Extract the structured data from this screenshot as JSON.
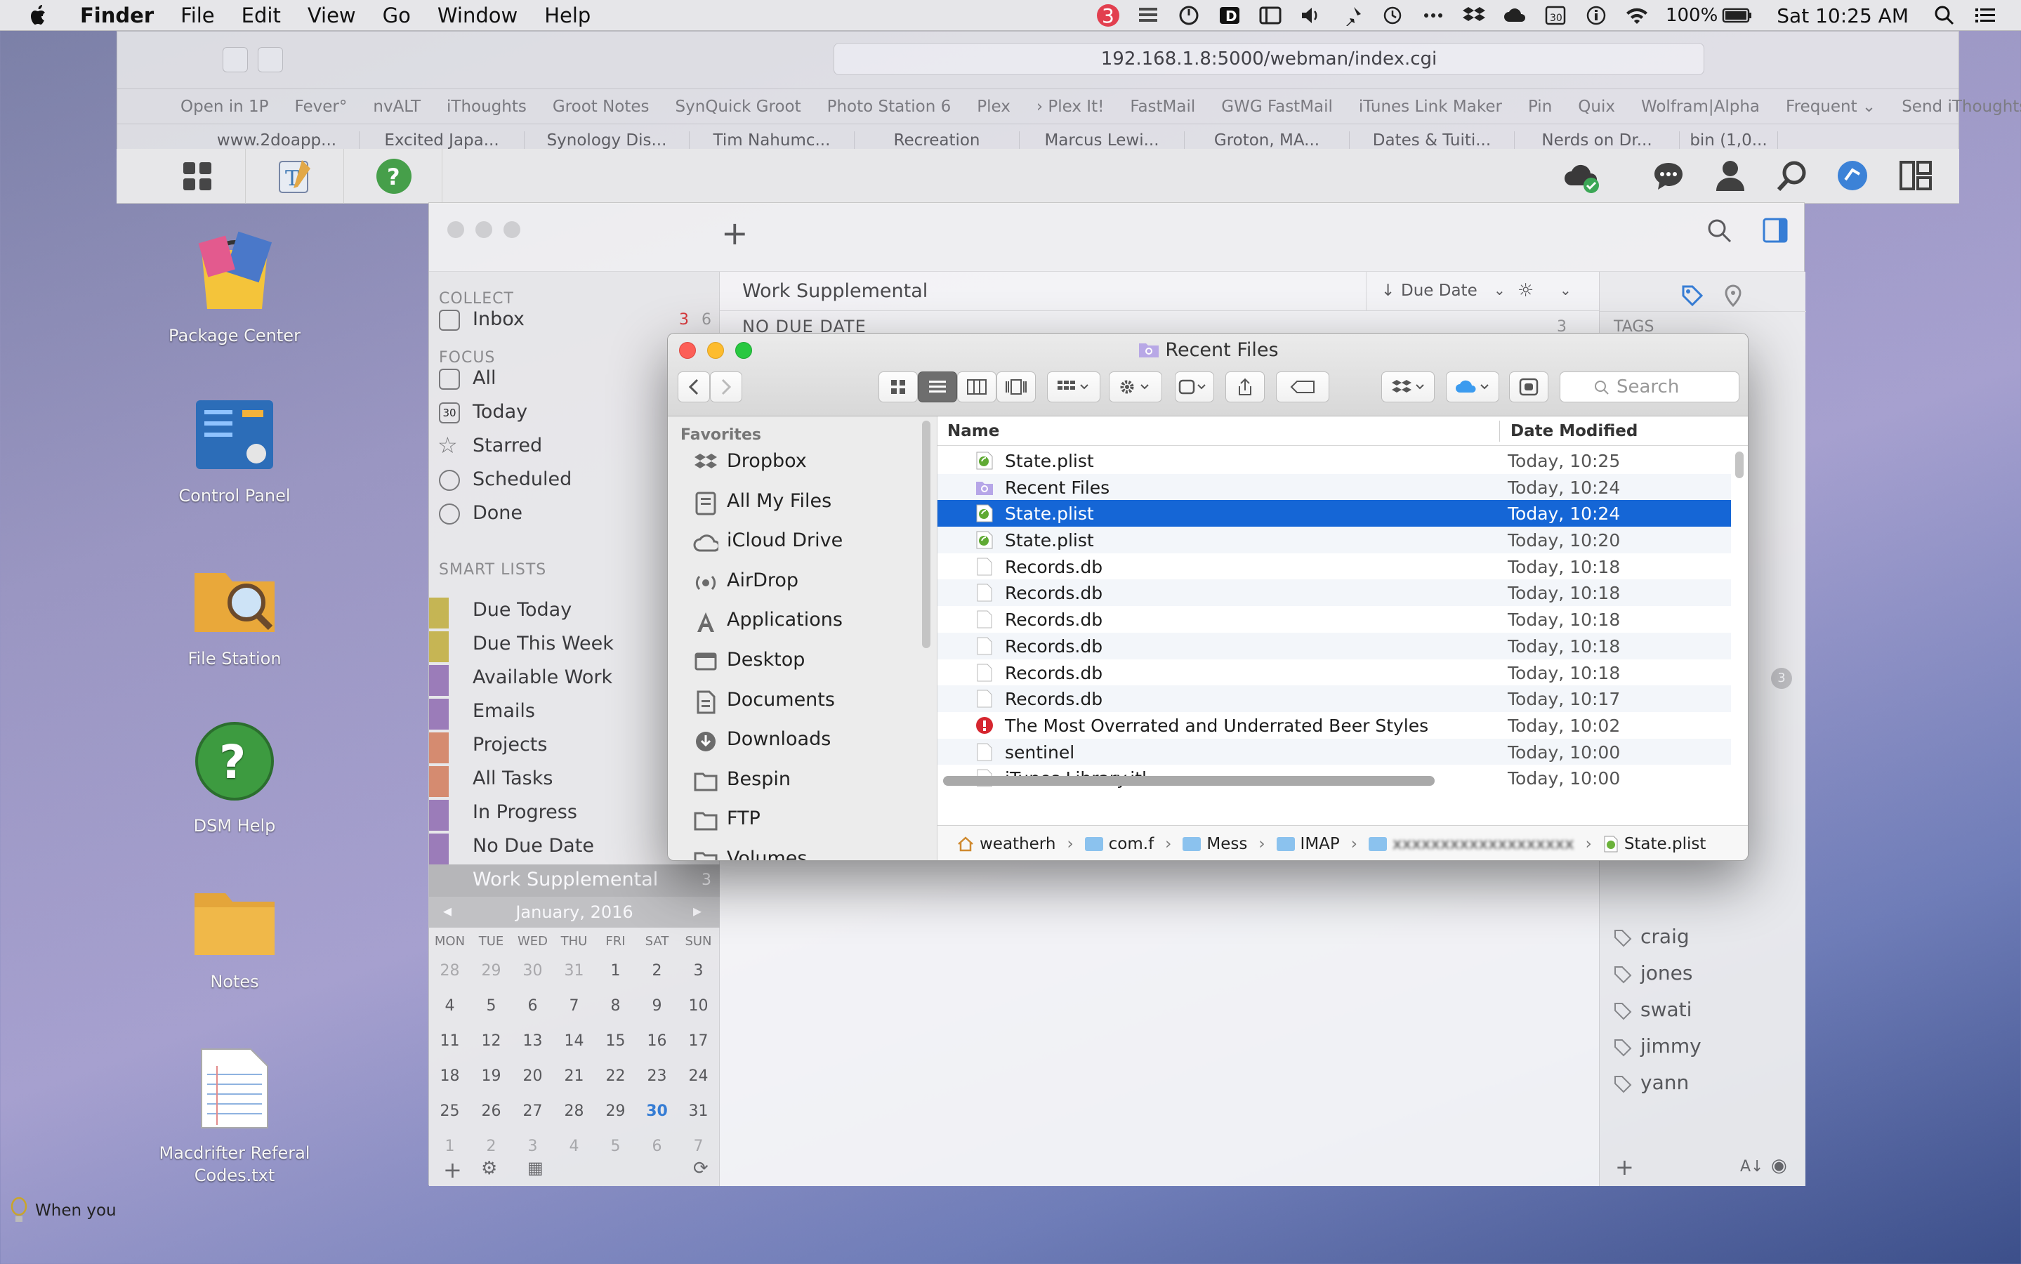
{
  "menubar": {
    "app": "Finder",
    "items": [
      "File",
      "Edit",
      "View",
      "Go",
      "Window",
      "Help"
    ],
    "notification_count": "3",
    "calendar_day": "30",
    "battery": "100%",
    "clock": "Sat 10:25 AM"
  },
  "browser": {
    "url": "192.168.1.8:5000/webman/index.cgi",
    "bookmarks": [
      "Open in 1P",
      "Fever°",
      "nvALT",
      "iThoughts",
      "Groot Notes",
      "SynQuick Groot",
      "Photo Station 6",
      "Plex",
      "› Plex It!",
      "FastMail",
      "GWG FastMail",
      "iTunes Link Maker",
      "Pin",
      "Quix",
      "Wolfram|Alpha",
      "Frequent ⌄",
      "Send iThoughts"
    ],
    "tabs": [
      "www.2doapp...",
      "Excited Japa...",
      "Synology Dis...",
      "Tim Nahumc...",
      "Recreation",
      "Marcus Lewi...",
      "Groton, MA...",
      "Dates & Tuiti...",
      "Nerds on Dr...",
      "bin (1,0..."
    ]
  },
  "desktop_icons": [
    "Package Center",
    "Control Panel",
    "File Station",
    "DSM Help",
    "Notes",
    "Macdrifter Referal Codes.txt"
  ],
  "todo": {
    "list_title": "Work Supplemental",
    "sort_label": "Due Date",
    "section": "NO DUE DATE",
    "section_count": "3",
    "collect_head": "COLLECT",
    "inbox": {
      "label": "Inbox",
      "red": "3",
      "gray": "6"
    },
    "focus_head": "FOCUS",
    "focus_items": [
      "All",
      "Today",
      "Starred",
      "Scheduled",
      "Done"
    ],
    "today_icon_day": "30",
    "smart_head": "SMART LISTS",
    "smart_items": [
      "Due Today",
      "Due This Week",
      "Available Work",
      "Emails",
      "Projects",
      "All Tasks",
      "In Progress",
      "No Due Date",
      "Work Supplemental"
    ],
    "work_supplemental_count": "3",
    "calendar": {
      "month": "January, 2016",
      "weekdays": [
        "MON",
        "TUE",
        "WED",
        "THU",
        "FRI",
        "SAT",
        "SUN"
      ],
      "weeks": [
        [
          "28",
          "29",
          "30",
          "31",
          "1",
          "2",
          "3"
        ],
        [
          "4",
          "5",
          "6",
          "7",
          "8",
          "9",
          "10"
        ],
        [
          "11",
          "12",
          "13",
          "14",
          "15",
          "16",
          "17"
        ],
        [
          "18",
          "19",
          "20",
          "21",
          "22",
          "23",
          "24"
        ],
        [
          "25",
          "26",
          "27",
          "28",
          "29",
          "30",
          "31"
        ],
        [
          "1",
          "2",
          "3",
          "4",
          "5",
          "6",
          "7"
        ]
      ],
      "today": "30"
    },
    "tags_head": "TAGS",
    "tags": [
      "craig",
      "jones",
      "swati",
      "jimmy",
      "yann"
    ],
    "rp_count": "3"
  },
  "finder": {
    "title": "Recent Files",
    "search_placeholder": "Search",
    "favorites_head": "Favorites",
    "favorites": [
      "Dropbox",
      "All My Files",
      "iCloud Drive",
      "AirDrop",
      "Applications",
      "Desktop",
      "Documents",
      "Downloads",
      "Bespin",
      "FTP",
      "Volumes"
    ],
    "columns": {
      "name": "Name",
      "date": "Date Modified"
    },
    "files": [
      {
        "name": "State.plist",
        "date": "Today, 10:25",
        "icon": "plist-icon"
      },
      {
        "name": "Recent Files",
        "date": "Today, 10:24",
        "icon": "smart-folder-icon"
      },
      {
        "name": "State.plist",
        "date": "Today, 10:24",
        "icon": "plist-icon",
        "selected": true
      },
      {
        "name": "State.plist",
        "date": "Today, 10:20",
        "icon": "plist-icon"
      },
      {
        "name": "Records.db",
        "date": "Today, 10:18",
        "icon": "document-icon"
      },
      {
        "name": "Records.db",
        "date": "Today, 10:18",
        "icon": "document-icon"
      },
      {
        "name": "Records.db",
        "date": "Today, 10:18",
        "icon": "document-icon"
      },
      {
        "name": "Records.db",
        "date": "Today, 10:18",
        "icon": "document-icon"
      },
      {
        "name": "Records.db",
        "date": "Today, 10:18",
        "icon": "document-icon"
      },
      {
        "name": "Records.db",
        "date": "Today, 10:17",
        "icon": "document-icon"
      },
      {
        "name": "The Most Overrated and Underrated Beer Styles",
        "date": "Today, 10:02",
        "icon": "web-document-icon"
      },
      {
        "name": "sentinel",
        "date": "Today, 10:00",
        "icon": "document-icon"
      },
      {
        "name": "iTunes Library.itl",
        "date": "Today, 10:00",
        "icon": "document-icon"
      }
    ],
    "path": [
      "weatherh",
      "com.f",
      "Mess",
      "IMAP",
      "xxxxxxxxxxxxxxxxxxx",
      "State.plist"
    ]
  },
  "hint_text": "When you",
  "colors": {
    "selection": "#1566d6",
    "close": "#fc5f57",
    "minimize": "#fdbc2e",
    "zoom": "#28c840"
  }
}
